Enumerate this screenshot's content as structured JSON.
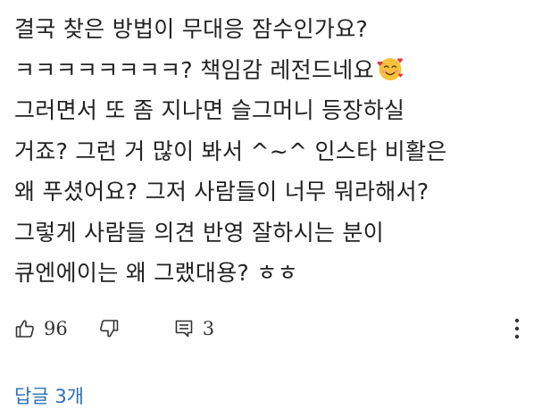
{
  "comment": {
    "lines": [
      "결국 찾은 방법이 무대응 잠수인가요?",
      "ㅋㅋㅋㅋㅋㅋㅋㅋ? 책임감 레전드네요",
      "그러면서 또 좀 지나면 슬그머니 등장하실",
      "거죠? 그런 거 많이 봐서 ^~^ 인스타 비활은",
      "왜 푸셨어요? 그저 사람들이 너무 뭐라해서?",
      "그렇게 사람들 의견 반영 잘하시는 분이",
      "큐엔에이는 왜 그랬대용? ㅎㅎ"
    ],
    "emoji": "smiling-face-with-hearts"
  },
  "actions": {
    "like_count": "96",
    "reply_count": "3",
    "like_icon": "thumbs-up-icon",
    "dislike_icon": "thumbs-down-icon",
    "reply_icon": "comment-icon",
    "more_icon": "more-vertical-icon"
  },
  "replies_link": "답글 3개",
  "colors": {
    "text": "#222222",
    "link": "#2e6fb8",
    "icon": "#333333",
    "emoji_face": "#f7c23b",
    "emoji_heart": "#e8343d"
  }
}
